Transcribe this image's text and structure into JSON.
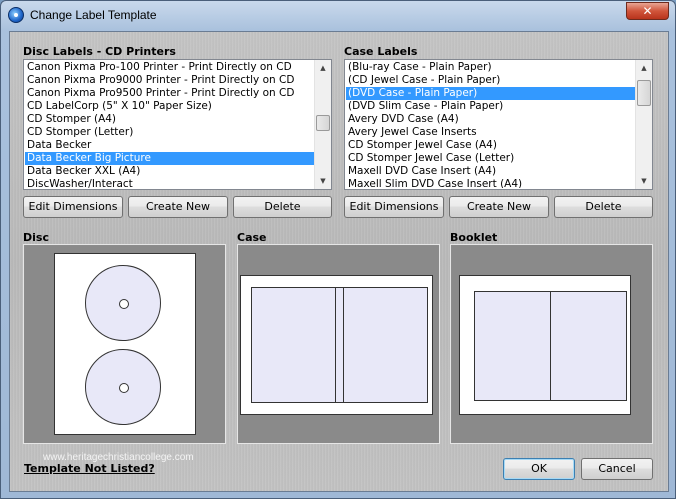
{
  "window": {
    "title": "Change Label Template",
    "close_label": "✕"
  },
  "disc_labels": {
    "heading": "Disc Labels - CD Printers",
    "items": [
      "Canon Pixma Pro-100 Printer - Print Directly on CD",
      "Canon Pixma Pro9000 Printer - Print Directly on CD",
      "Canon Pixma Pro9500 Printer - Print Directly on CD",
      "CD LabelCorp (5\" X 10\" Paper Size)",
      "CD Stomper (A4)",
      "CD Stomper (Letter)",
      "Data Becker",
      "Data Becker Big Picture",
      "Data Becker XXL (A4)",
      "DiscWasher/Interact"
    ],
    "selected_index": 7,
    "buttons": {
      "edit": "Edit Dimensions",
      "create": "Create New",
      "delete": "Delete"
    }
  },
  "case_labels": {
    "heading": "Case Labels",
    "items": [
      "(Blu-ray Case - Plain Paper)",
      "(CD Jewel Case - Plain Paper)",
      "(DVD Case - Plain Paper)",
      "(DVD Slim Case - Plain Paper)",
      "Avery DVD Case (A4)",
      "Avery Jewel Case Inserts",
      "CD Stomper Jewel Case (A4)",
      "CD Stomper Jewel Case (Letter)",
      "Maxell DVD Case Insert (A4)",
      "Maxell Slim DVD Case Insert (A4)"
    ],
    "selected_index": 2,
    "buttons": {
      "edit": "Edit Dimensions",
      "create": "Create New",
      "delete": "Delete"
    }
  },
  "previews": {
    "disc": "Disc",
    "case": "Case",
    "booklet": "Booklet"
  },
  "watermark": "www.heritagechristiancollege.com",
  "footer": {
    "template_link": "Template Not Listed?",
    "ok": "OK",
    "cancel": "Cancel"
  },
  "colors": {
    "selection": "#3399ff",
    "label_fill": "#e8e8f8"
  }
}
